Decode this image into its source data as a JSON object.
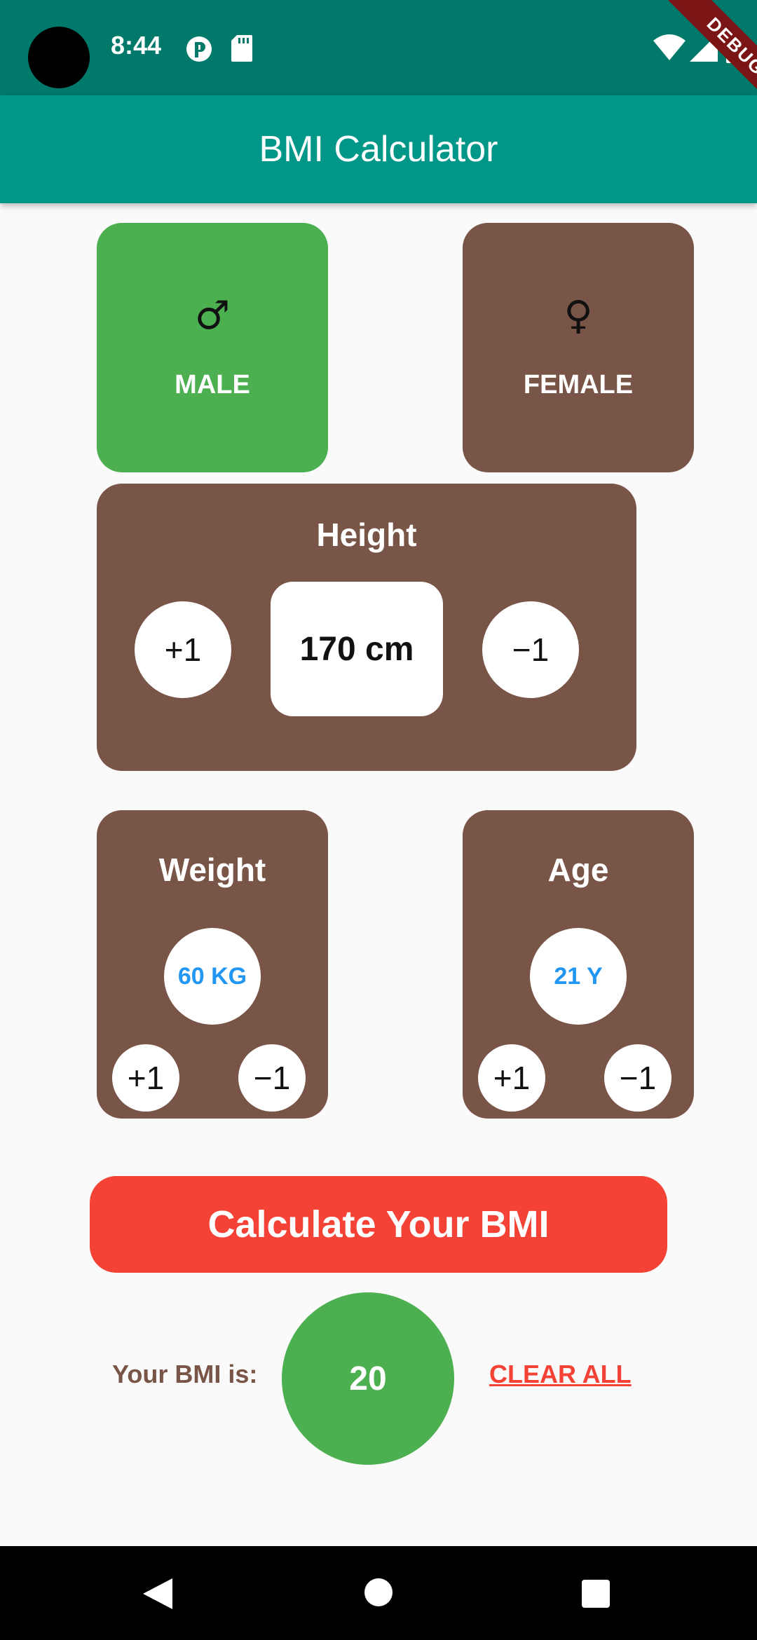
{
  "status_bar": {
    "time": "8:44",
    "icons": [
      "camera-cutout",
      "alarm-icon",
      "sd-card-icon",
      "wifi-icon",
      "signal-icon",
      "battery-icon"
    ],
    "debug_banner": "DEBUG"
  },
  "app_bar": {
    "title": "BMI Calculator",
    "color": "#009688"
  },
  "gender": {
    "male": {
      "symbol": "♂",
      "label": "MALE",
      "selected": true,
      "color": "#4caf50"
    },
    "female": {
      "symbol": "♀",
      "label": "FEMALE",
      "selected": false,
      "color": "#795548"
    }
  },
  "height": {
    "title": "Height",
    "value": "170 cm",
    "increment_label": "+1",
    "decrement_label": "−1"
  },
  "weight": {
    "title": "Weight",
    "value": "60 KG",
    "increment_label": "+1",
    "decrement_label": "−1"
  },
  "age": {
    "title": "Age",
    "value": "21 Y",
    "increment_label": "+1",
    "decrement_label": "−1"
  },
  "calculate_button": {
    "label": "Calculate Your BMI",
    "color": "#f44336"
  },
  "result": {
    "label": "Your BMI is:",
    "value": "20",
    "clear_label": "CLEAR ALL"
  },
  "nav_bar": {
    "buttons": [
      "back-icon",
      "home-icon",
      "recents-icon"
    ]
  },
  "colors": {
    "card": "#795548",
    "accent_value": "#2196f3",
    "status_bar": "#00796b"
  }
}
